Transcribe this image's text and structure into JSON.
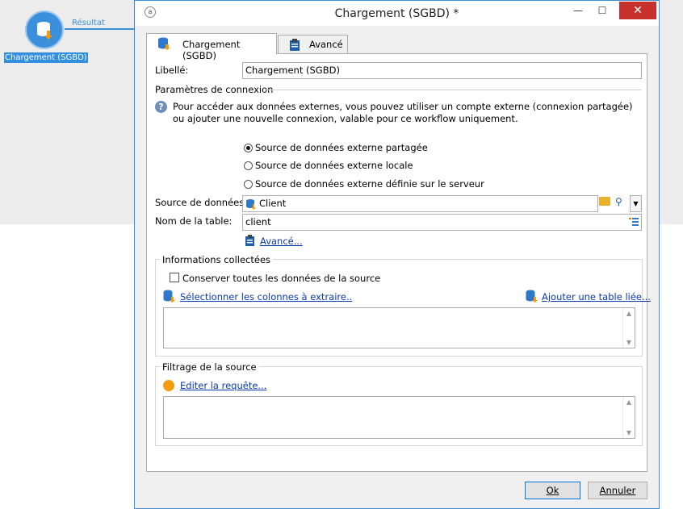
{
  "workflow": {
    "node_label": "Chargement (SGBD)",
    "transition_label": "Résultat"
  },
  "window": {
    "title": "Chargement (SGBD) *",
    "minimize": "—",
    "maximize": "☐",
    "close": "✕"
  },
  "tabs": [
    {
      "label": "Chargement (SGBD)",
      "active": true
    },
    {
      "label": "Avancé",
      "active": false
    }
  ],
  "form": {
    "libelle_label": "Libellé:",
    "libelle_value": "Chargement (SGBD)",
    "connection_section": "Paramètres de connexion",
    "help_text": "Pour accéder aux données externes, vous pouvez utiliser un compte externe (connexion partagée) ou ajouter une nouvelle connexion, valable pour ce workflow uniquement.",
    "radios": [
      {
        "label": "Source de données externe partagée",
        "selected": true
      },
      {
        "label": "Source de données externe locale",
        "selected": false
      },
      {
        "label": "Source de données externe définie sur le serveur",
        "selected": false
      }
    ],
    "datasource_label": "Source de données:",
    "datasource_value": "Client",
    "table_label": "Nom de la table:",
    "table_value": "client",
    "advanced_link": "Avancé..."
  },
  "collected": {
    "title": "Informations collectées",
    "keep_all_label": "Conserver toutes les données de la source",
    "keep_all_checked": false,
    "select_columns_link": "Sélectionner les colonnes à extraire..",
    "add_table_link": "Ajouter une table liée..."
  },
  "filter": {
    "title": "Filtrage de la source",
    "edit_query_link": "Editer la requête..."
  },
  "buttons": {
    "ok": "Ok",
    "cancel": "Annuler"
  },
  "colors": {
    "accent": "#3b8fdb",
    "close_button": "#c7312b",
    "link": "#0a3ab0",
    "orange": "#f39c12"
  }
}
